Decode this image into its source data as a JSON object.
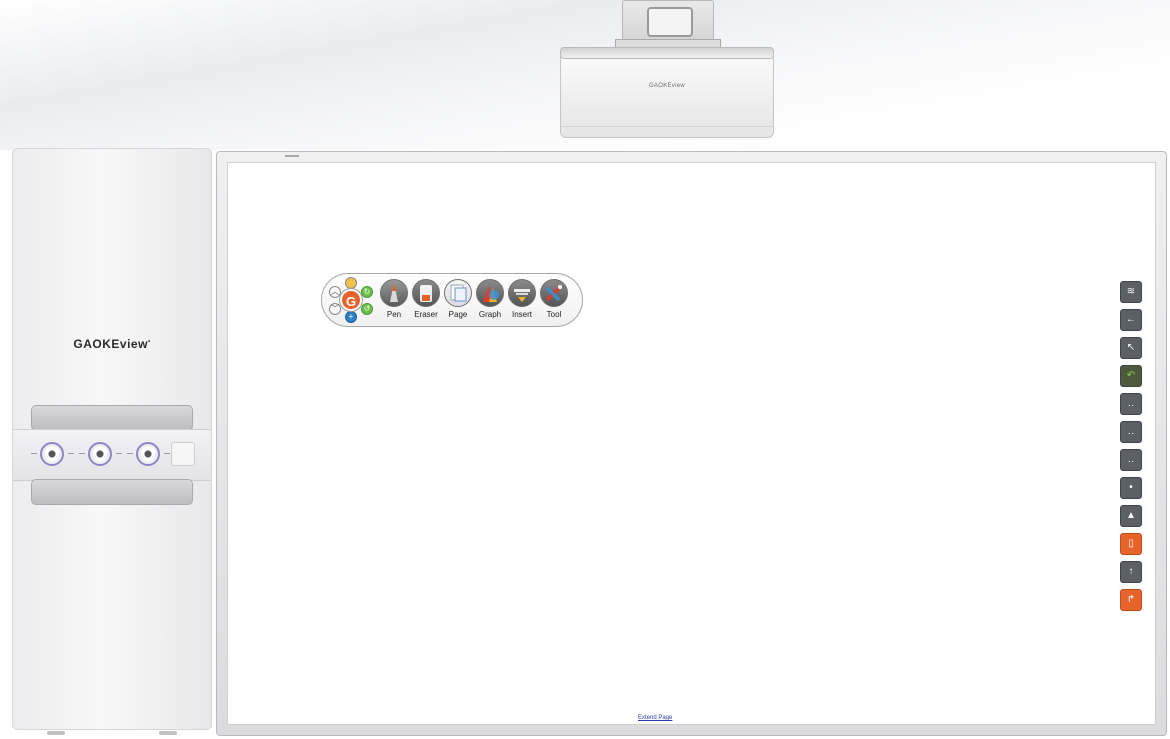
{
  "projector": {
    "brand": "GAOKEview"
  },
  "cabinet": {
    "logo_text": "GAOKEview",
    "logo_mark": "•",
    "knobs": [
      "knob-1",
      "knob-2",
      "knob-3"
    ]
  },
  "toolbar": {
    "logo_letter": "G",
    "tools": [
      {
        "label": "Pen",
        "icon": "pen-icon"
      },
      {
        "label": "Eraser",
        "icon": "eraser-icon"
      },
      {
        "label": "Page",
        "icon": "page-icon"
      },
      {
        "label": "Graph",
        "icon": "graph-icon"
      },
      {
        "label": "Insert",
        "icon": "insert-icon"
      },
      {
        "label": "Tool",
        "icon": "tool-icon"
      }
    ]
  },
  "board": {
    "extend_link": "Extend Page"
  },
  "side_toolbar": {
    "buttons": [
      {
        "icon": "screen-icon",
        "color": "#5b5f66"
      },
      {
        "icon": "back-icon",
        "color": "#5b5f66"
      },
      {
        "icon": "select-icon",
        "color": "#5b5f66"
      },
      {
        "icon": "undo-icon",
        "color": "#4e5a3e"
      },
      {
        "icon": "dots-icon",
        "color": "#5b5f66"
      },
      {
        "icon": "dots-icon",
        "color": "#5b5f66"
      },
      {
        "icon": "dots-icon",
        "color": "#5b5f66"
      },
      {
        "icon": "dot-icon",
        "color": "#5b5f66"
      },
      {
        "icon": "pen-icon",
        "color": "#5b5f66"
      },
      {
        "icon": "eraser-icon",
        "color": "#e6642b"
      },
      {
        "icon": "arrow-up-icon",
        "color": "#5b5f66"
      },
      {
        "icon": "exit-icon",
        "color": "#e6642b"
      }
    ]
  }
}
